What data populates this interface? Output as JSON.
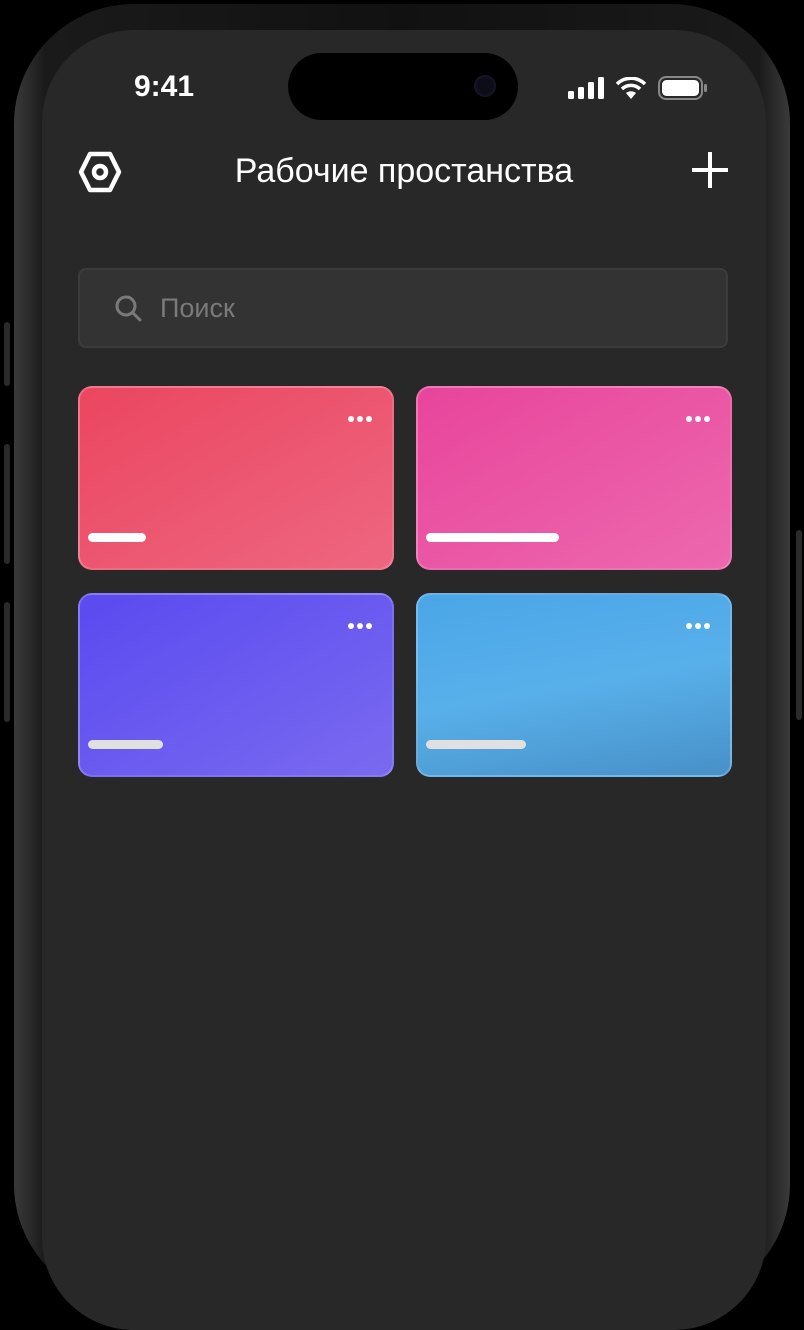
{
  "status_bar": {
    "time": "9:41"
  },
  "header": {
    "title": "Рабочие простанства",
    "settings_icon": "hex-gear-icon",
    "add_icon": "plus-icon"
  },
  "search": {
    "placeholder": "Поиск",
    "value": "",
    "icon": "search-icon"
  },
  "workspaces": [
    {
      "color_from": "#eb4660",
      "color_to": "#ee6680",
      "name_bar_color": "#ffffff"
    },
    {
      "color_from": "#e8459b",
      "color_to": "#ed68ae",
      "name_bar_color": "#ffffff"
    },
    {
      "color_from": "#5a4af0",
      "color_to": "#7a6af0",
      "name_bar_color": "#e0e0e0"
    },
    {
      "color_from": "#4ba6e8",
      "color_to": "#4890c8",
      "name_bar_color": "#e0e0e0"
    }
  ],
  "colors": {
    "background": "#282828",
    "search_bg": "#333333"
  }
}
